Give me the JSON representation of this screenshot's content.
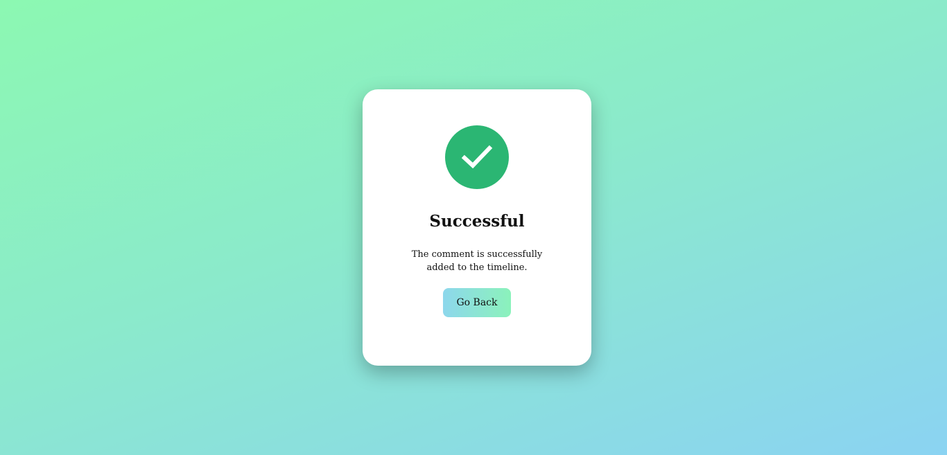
{
  "dialog": {
    "title": "Successful",
    "message": "The comment is successfully added to the timeline.",
    "button_label": "Go Back",
    "icon": "check-circle-icon"
  },
  "colors": {
    "success": "#2bb673",
    "background_start": "#8cf8b2",
    "background_end": "#8bd3f2",
    "button_start": "#8dd7ec",
    "button_end": "#8bf2bb"
  }
}
